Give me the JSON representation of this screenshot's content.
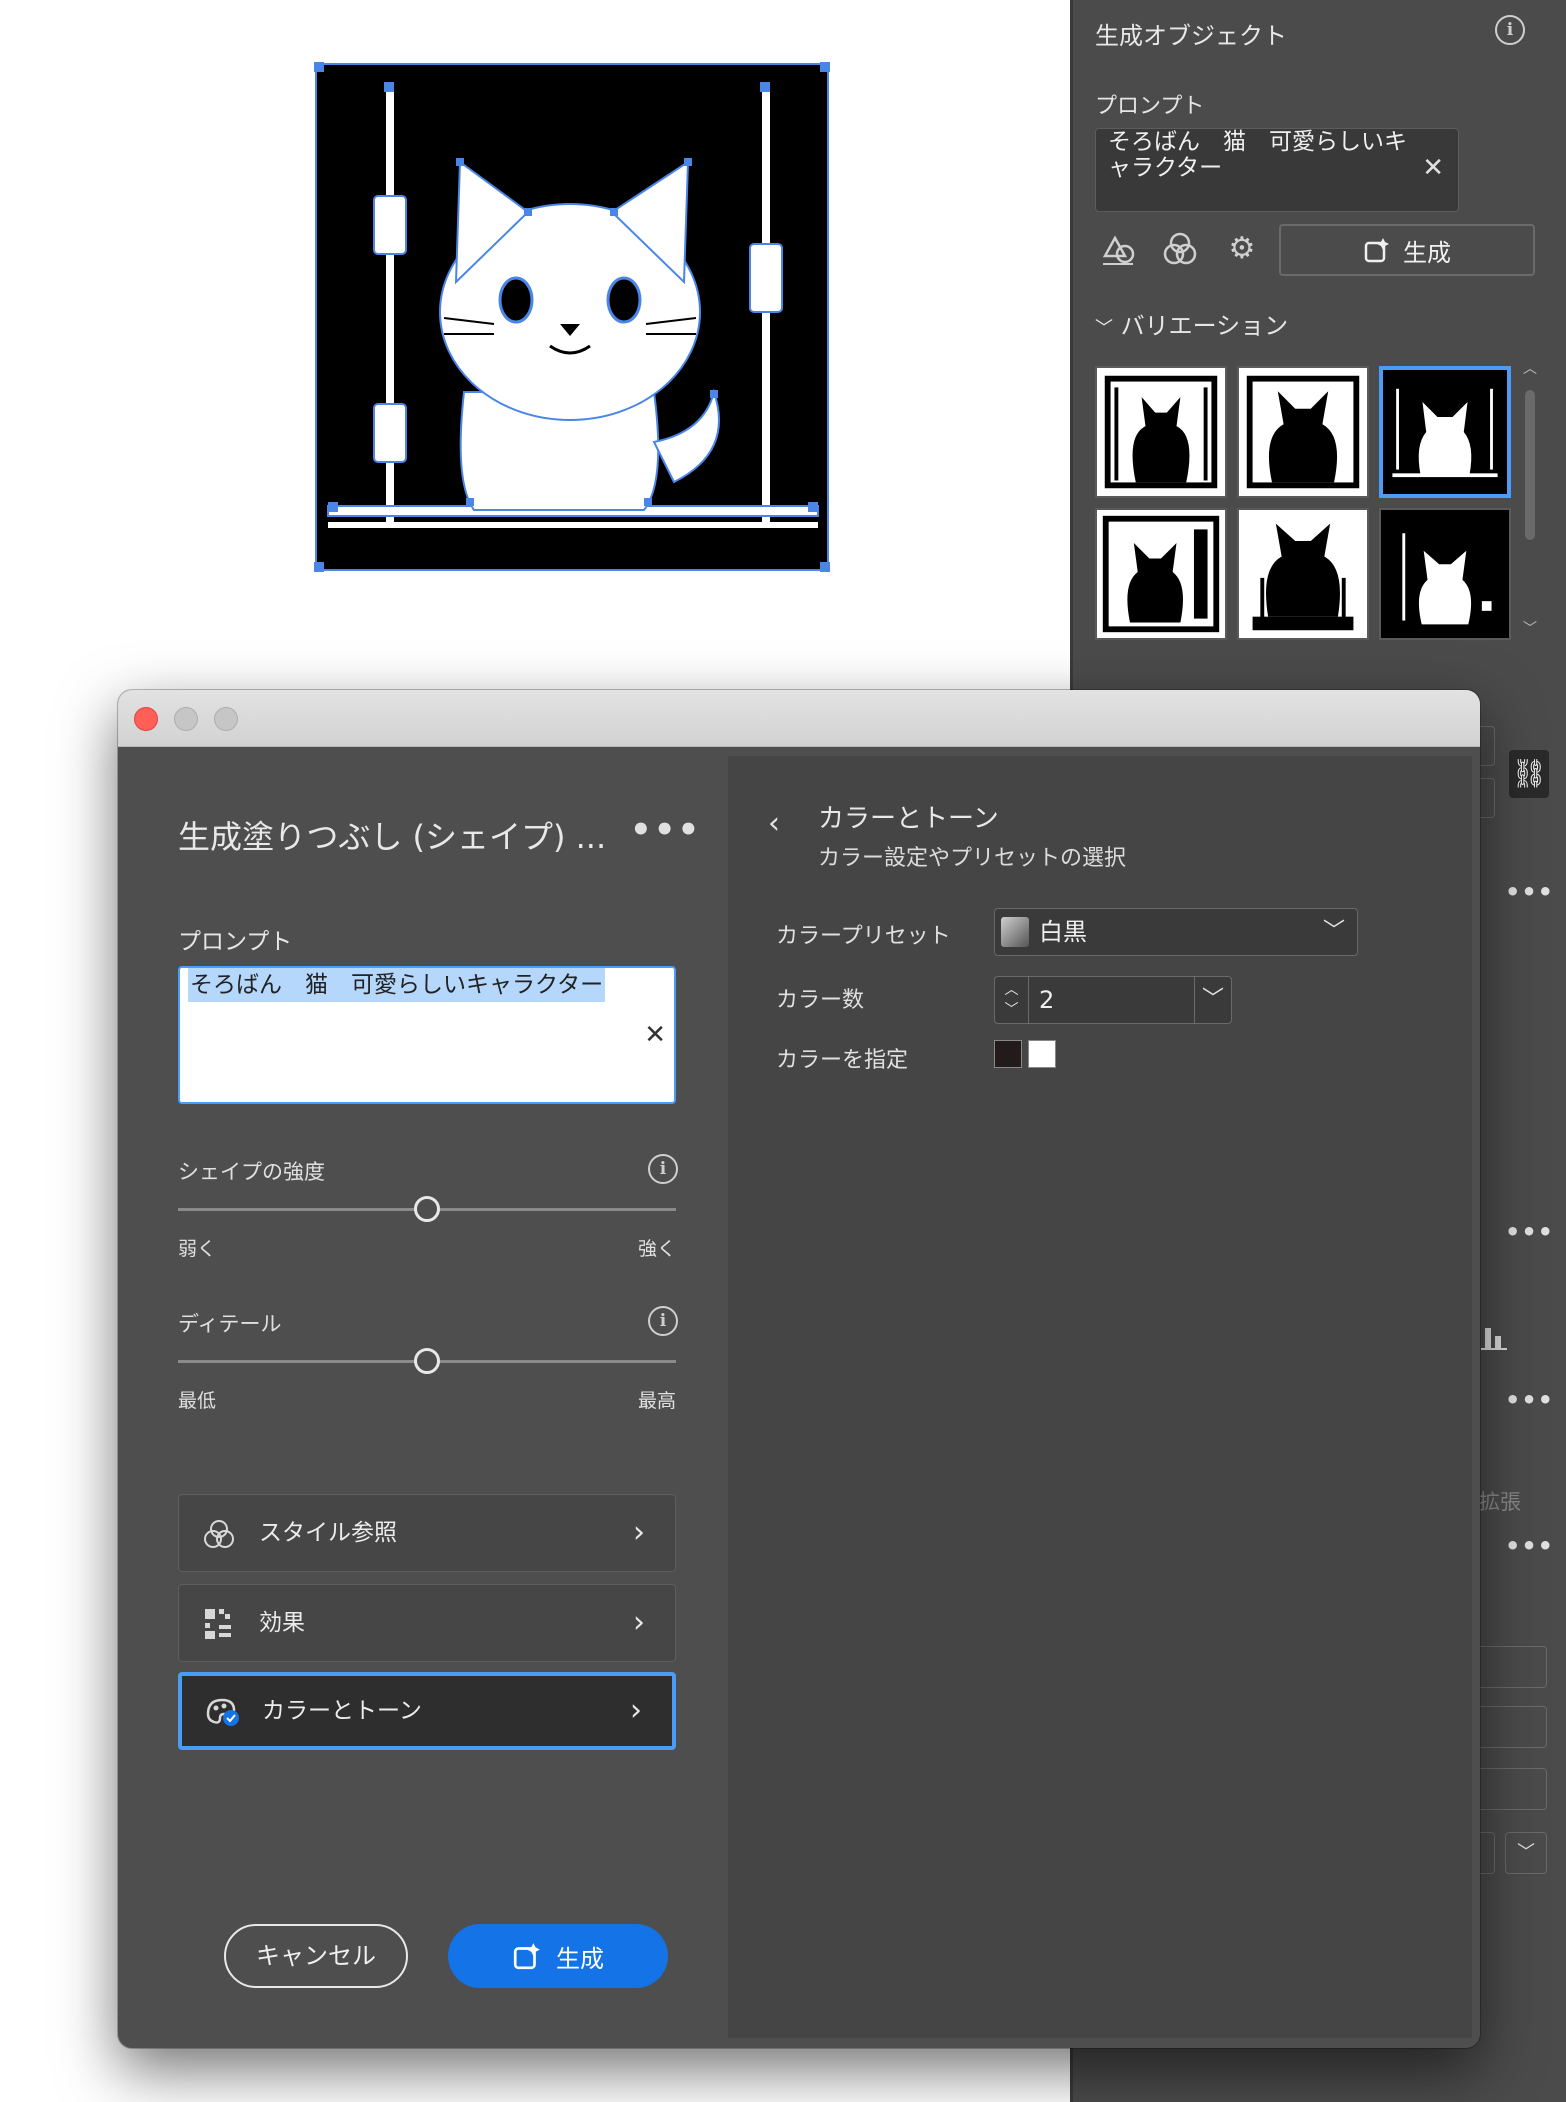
{
  "props_panel": {
    "title": "生成オブジェクト",
    "prompt_label": "プロンプト",
    "prompt_text": "そろばん　猫　可愛らしいキャラクター",
    "generate_label": "生成",
    "variations_label": "バリエーション",
    "partial_label": "拡張"
  },
  "dialog": {
    "title": "生成塗りつぶし (シェイプ) ...",
    "prompt_label": "プロンプト",
    "prompt_text": "そろばん　猫　可愛らしいキャラクター",
    "shape_strength": {
      "label": "シェイプの強度",
      "min_label": "弱く",
      "max_label": "強く",
      "value": 0.5
    },
    "detail": {
      "label": "ディテール",
      "min_label": "最低",
      "max_label": "最高",
      "value": 0.5
    },
    "nav": {
      "style_ref": "スタイル参照",
      "effects": "効果",
      "color_tone": "カラーとトーン"
    },
    "cancel_label": "キャンセル",
    "generate_label": "生成",
    "color_panel": {
      "title": "カラーとトーン",
      "subtitle": "カラー設定やプリセットの選択",
      "preset_label": "カラープリセット",
      "preset_value": "白黒",
      "count_label": "カラー数",
      "count_value": "2",
      "specify_label": "カラーを指定",
      "swatches": [
        "#231a1c",
        "#ffffff"
      ]
    }
  },
  "colors": {
    "accent": "#4b9cf5",
    "primary_button": "#1473e6",
    "close": "#fe5f57"
  }
}
